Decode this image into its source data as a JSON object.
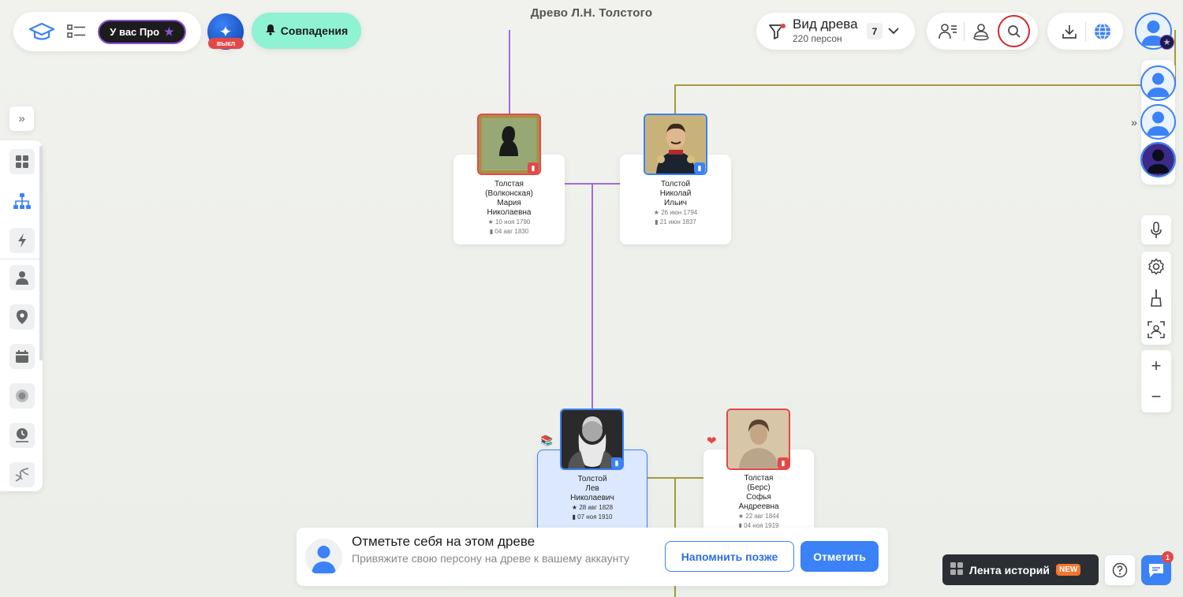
{
  "header": {
    "title": "Древо Л.Н. Толстого",
    "pro_badge": "У вас Про",
    "ai_toggle_state": "выкл",
    "matches_label": "Совпадения",
    "tree_view": {
      "title": "Вид древа",
      "subtitle": "220 персон",
      "generations": "7"
    }
  },
  "persons": {
    "mother": {
      "name_lines": [
        "Толстая",
        "(Волконская)",
        "Мария",
        "Николаевна"
      ],
      "birth": "10 ноя 1790",
      "death": "04 авг 1830"
    },
    "father": {
      "name_lines": [
        "Толстой",
        "Николай",
        "Ильич"
      ],
      "birth": "26 июн 1794",
      "death": "21 июн 1837"
    },
    "main": {
      "name_lines": [
        "Толстой",
        "Лев",
        "Николаевич"
      ],
      "birth": "28 авг 1828",
      "death": "07 ноя 1910"
    },
    "spouse": {
      "name_lines": [
        "Толстая",
        "(Берс)",
        "Софья",
        "Андреевна"
      ],
      "birth": "22 авг 1844",
      "death": "04 ноя 1919"
    }
  },
  "banner": {
    "title": "Отметьте себя на этом древе",
    "text": "Привяжите свою персону на древе к вашему аккаунту",
    "later_button": "Напомнить позже",
    "mark_button": "Отметить"
  },
  "footer": {
    "stories_label": "Лента историй",
    "new_badge": "NEW",
    "chat_count": "1"
  },
  "colors": {
    "accent": "#3b82f6",
    "female_tag": "#e34848",
    "male_tag": "#3b82f6",
    "matches_bg": "#8ff2d2",
    "tree_line_purple": "#a46bd6",
    "tree_line_olive": "#a49a3e"
  }
}
